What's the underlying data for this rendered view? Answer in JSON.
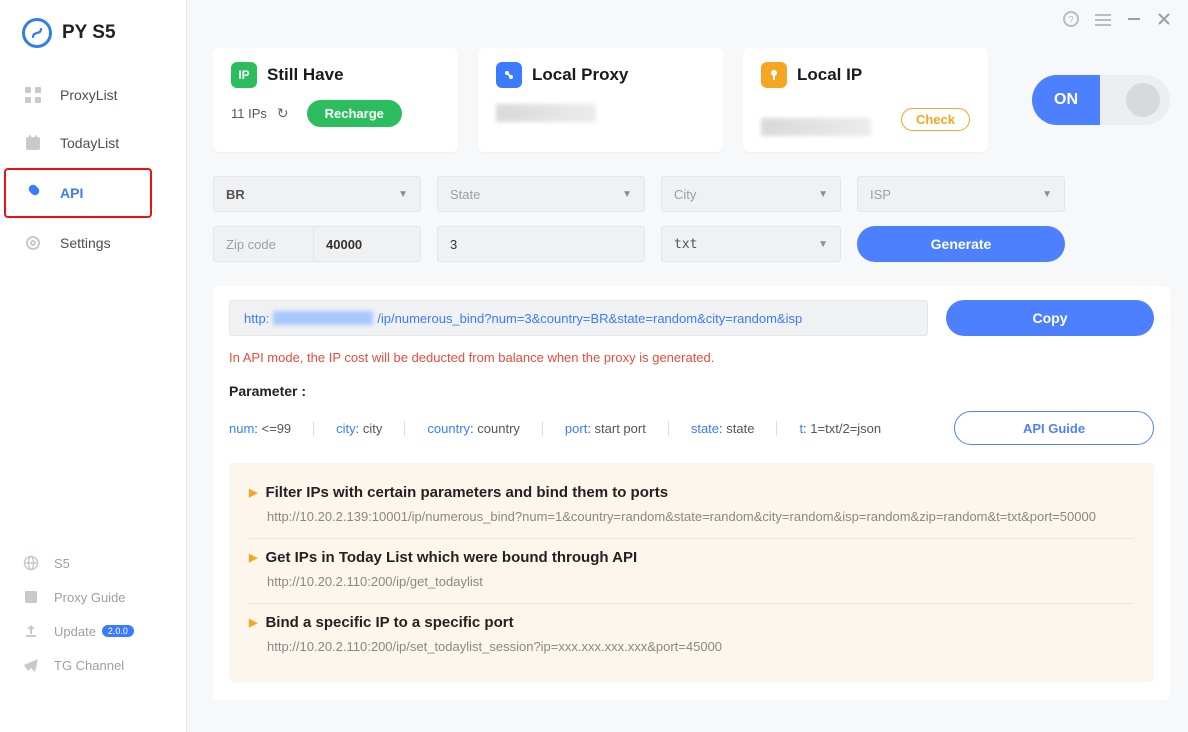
{
  "app": {
    "name": "PY S5"
  },
  "titlebar": {
    "help": "?",
    "menu": "≡",
    "min": "—",
    "close": "✕"
  },
  "sidebar": {
    "items": [
      {
        "label": "ProxyList"
      },
      {
        "label": "TodayList"
      },
      {
        "label": "API"
      },
      {
        "label": "Settings"
      }
    ],
    "bottom": [
      {
        "label": "S5"
      },
      {
        "label": "Proxy Guide"
      },
      {
        "label": "Update",
        "badge": "2.0.0"
      },
      {
        "label": "TG Channel"
      }
    ]
  },
  "cards": {
    "still": {
      "title": "Still Have",
      "ips": "11 IPs",
      "recharge": "Recharge"
    },
    "local_proxy": {
      "title": "Local Proxy"
    },
    "local_ip": {
      "title": "Local IP",
      "check": "Check"
    }
  },
  "toggle": {
    "on_label": "ON"
  },
  "filters": {
    "country": "BR",
    "state_ph": "State",
    "city_ph": "City",
    "isp_ph": "ISP",
    "zip_label": "Zip code",
    "zip_value": "40000",
    "count_value": "3",
    "format_value": "txt",
    "generate": "Generate"
  },
  "api": {
    "url_prefix": "http:",
    "url_suffix": "/ip/numerous_bind?num=3&country=BR&state=random&city=random&isp",
    "copy": "Copy",
    "warning": "In API mode, the IP cost will be deducted from balance when the proxy is generated.",
    "param_head": "Parameter :",
    "params": {
      "num_k": "num",
      "num_v": ": <=99",
      "city_k": "city",
      "city_v": ": city",
      "country_k": "country",
      "country_v": ": country",
      "port_k": "port",
      "port_v": ": start port",
      "state_k": "state",
      "state_v": ": state",
      "t_k": "t",
      "t_v": ": 1=txt/2=json"
    },
    "guide": "API Guide"
  },
  "accordion": [
    {
      "title": "Filter IPs with certain parameters and bind them to ports",
      "url": "http://10.20.2.139:10001/ip/numerous_bind?num=1&country=random&state=random&city=random&isp=random&zip=random&t=txt&port=50000"
    },
    {
      "title": "Get IPs in Today List which were bound through API",
      "url": "http://10.20.2.110:200/ip/get_todaylist"
    },
    {
      "title": "Bind a specific IP to a specific port",
      "url": "http://10.20.2.110:200/ip/set_todaylist_session?ip=xxx.xxx.xxx.xxx&port=45000"
    }
  ]
}
